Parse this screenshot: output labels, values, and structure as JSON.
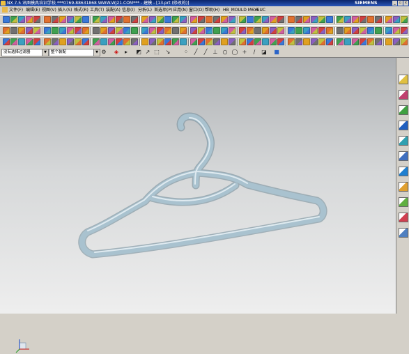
{
  "title_bar": {
    "title": "NX 7.5 讯图模具培训学校  ***0769-88631868  WWW.WJ21.COM***  - 建模 - [13.prt (修改的)]",
    "brand": "SIEMENS",
    "buttons": [
      "_",
      "▫",
      "x"
    ]
  },
  "menu_bar": {
    "items": [
      "文件(F)",
      "编辑(E)",
      "视图(V)",
      "插入(S)",
      "格式(R)",
      "工具(T)",
      "装配(A)",
      "信息(I)",
      "分析(L)",
      "首选项(P)",
      "应用(N)",
      "窗口(O)",
      "帮助(H)",
      "HB_MOULD M6.6",
      "YSUC"
    ]
  },
  "selection_bar": {
    "type_filter": "没有选择过滤器",
    "scope": "整个装配"
  },
  "toolbar_icons": [
    "feature-icon",
    "sketch-icon",
    "extrude-icon",
    "revolve-icon",
    "hole-icon",
    "blend-icon",
    "chamfer-icon",
    "shell-icon",
    "pattern-icon",
    "mirror-icon",
    "trim-icon",
    "boolean-icon",
    "surface-icon",
    "curve-icon",
    "analysis-icon",
    "view-icon",
    "layer-icon",
    "render-icon"
  ],
  "snap_icons": [
    "snap-endpoint-icon",
    "snap-midpoint-icon",
    "snap-control-icon",
    "snap-intersection-icon",
    "snap-center-icon",
    "snap-quadrant-icon",
    "snap-point-icon",
    "snap-curve-icon",
    "snap-face-icon"
  ],
  "resource_bar": [
    "assembly-navigator-icon",
    "part-navigator-icon",
    "reuse-library-icon",
    "hd3d-tools-icon",
    "web-browser-icon",
    "history-icon",
    "system-materials-icon",
    "process-studio-icon",
    "manufacturing-wizards-icon",
    "roles-icon",
    "system-scenes-icon"
  ],
  "colors": {
    "model": "#a6bfcc",
    "viewport_top": "#adb0b3",
    "viewport_bottom": "#eeeeee"
  }
}
